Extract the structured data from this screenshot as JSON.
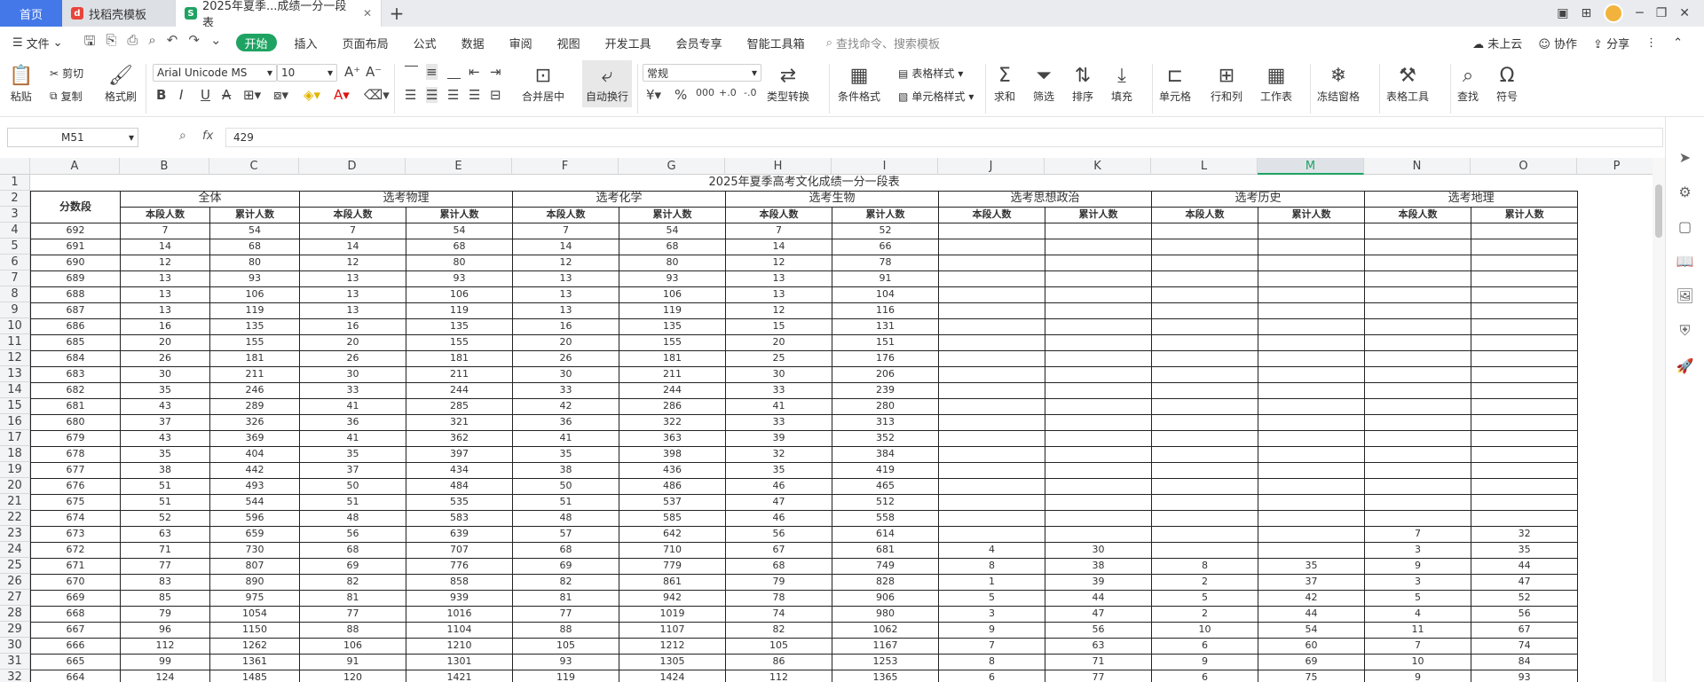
{
  "tabs": {
    "home": "首页",
    "t1": "找稻壳模板",
    "t2": "2025年夏季...成绩一分一段表"
  },
  "menu": {
    "file": "文件",
    "items": [
      "开始",
      "插入",
      "页面布局",
      "公式",
      "数据",
      "审阅",
      "视图",
      "开发工具",
      "会员专享",
      "智能工具箱"
    ],
    "search": "查找命令、搜索模板",
    "right": [
      "未上云",
      "协作",
      "分享"
    ]
  },
  "ribbon": {
    "paste": "粘贴",
    "cut": "剪切",
    "copy": "复制",
    "format_painter": "格式刷",
    "font_name": "Arial Unicode MS",
    "font_size": "10",
    "merge": "合并居中",
    "wrap": "自动换行",
    "number_format": "常规",
    "convert": "类型转换",
    "cond_format": "条件格式",
    "table_style": "表格样式",
    "cell_style": "单元格样式",
    "sum": "求和",
    "filter": "筛选",
    "sort": "排序",
    "fill": "填充",
    "cell": "单元格",
    "rowcol": "行和列",
    "worksheet": "工作表",
    "freeze": "冻结窗格",
    "table_tools": "表格工具",
    "find": "查找",
    "symbol": "符号"
  },
  "formula": {
    "cell_ref": "M51",
    "fx": "fx",
    "value": "429"
  },
  "grid": {
    "cols": [
      "A",
      "B",
      "C",
      "D",
      "E",
      "F",
      "G",
      "H",
      "I",
      "J",
      "K",
      "L",
      "M",
      "N",
      "O",
      "P"
    ],
    "selected_col": "M",
    "title": "2025年夏季高考文化成绩一分一段表",
    "score_header": "分数段",
    "groups": [
      "全体",
      "选考物理",
      "选考化学",
      "选考生物",
      "选考思想政治",
      "选考历史",
      "选考地理"
    ],
    "sub": [
      "本段人数",
      "累计人数"
    ],
    "row_numbers": [
      "1",
      "2",
      "3",
      "4",
      "5",
      "6",
      "7",
      "8",
      "9",
      "10",
      "11",
      "12",
      "13",
      "14",
      "15",
      "16",
      "17",
      "18",
      "19",
      "20",
      "21",
      "22",
      "23",
      "24",
      "25",
      "26",
      "27",
      "28",
      "29",
      "30",
      "31",
      "32"
    ],
    "rows": [
      [
        "692",
        "7",
        "54",
        "7",
        "54",
        "7",
        "54",
        "7",
        "52",
        "",
        "",
        "",
        "",
        "",
        ""
      ],
      [
        "691",
        "14",
        "68",
        "14",
        "68",
        "14",
        "68",
        "14",
        "66",
        "",
        "",
        "",
        "",
        "",
        ""
      ],
      [
        "690",
        "12",
        "80",
        "12",
        "80",
        "12",
        "80",
        "12",
        "78",
        "",
        "",
        "",
        "",
        "",
        ""
      ],
      [
        "689",
        "13",
        "93",
        "13",
        "93",
        "13",
        "93",
        "13",
        "91",
        "",
        "",
        "",
        "",
        "",
        ""
      ],
      [
        "688",
        "13",
        "106",
        "13",
        "106",
        "13",
        "106",
        "13",
        "104",
        "",
        "",
        "",
        "",
        "",
        ""
      ],
      [
        "687",
        "13",
        "119",
        "13",
        "119",
        "13",
        "119",
        "12",
        "116",
        "",
        "",
        "",
        "",
        "",
        ""
      ],
      [
        "686",
        "16",
        "135",
        "16",
        "135",
        "16",
        "135",
        "15",
        "131",
        "",
        "",
        "",
        "",
        "",
        ""
      ],
      [
        "685",
        "20",
        "155",
        "20",
        "155",
        "20",
        "155",
        "20",
        "151",
        "",
        "",
        "",
        "",
        "",
        ""
      ],
      [
        "684",
        "26",
        "181",
        "26",
        "181",
        "26",
        "181",
        "25",
        "176",
        "",
        "",
        "",
        "",
        "",
        ""
      ],
      [
        "683",
        "30",
        "211",
        "30",
        "211",
        "30",
        "211",
        "30",
        "206",
        "",
        "",
        "",
        "",
        "",
        ""
      ],
      [
        "682",
        "35",
        "246",
        "33",
        "244",
        "33",
        "244",
        "33",
        "239",
        "",
        "",
        "",
        "",
        "",
        ""
      ],
      [
        "681",
        "43",
        "289",
        "41",
        "285",
        "42",
        "286",
        "41",
        "280",
        "",
        "",
        "",
        "",
        "",
        ""
      ],
      [
        "680",
        "37",
        "326",
        "36",
        "321",
        "36",
        "322",
        "33",
        "313",
        "",
        "",
        "",
        "",
        "",
        ""
      ],
      [
        "679",
        "43",
        "369",
        "41",
        "362",
        "41",
        "363",
        "39",
        "352",
        "",
        "",
        "",
        "",
        "",
        ""
      ],
      [
        "678",
        "35",
        "404",
        "35",
        "397",
        "35",
        "398",
        "32",
        "384",
        "",
        "",
        "",
        "",
        "",
        ""
      ],
      [
        "677",
        "38",
        "442",
        "37",
        "434",
        "38",
        "436",
        "35",
        "419",
        "",
        "",
        "",
        "",
        "",
        ""
      ],
      [
        "676",
        "51",
        "493",
        "50",
        "484",
        "50",
        "486",
        "46",
        "465",
        "",
        "",
        "",
        "",
        "",
        ""
      ],
      [
        "675",
        "51",
        "544",
        "51",
        "535",
        "51",
        "537",
        "47",
        "512",
        "",
        "",
        "",
        "",
        "",
        ""
      ],
      [
        "674",
        "52",
        "596",
        "48",
        "583",
        "48",
        "585",
        "46",
        "558",
        "",
        "",
        "",
        "",
        "",
        ""
      ],
      [
        "673",
        "63",
        "659",
        "56",
        "639",
        "57",
        "642",
        "56",
        "614",
        "",
        "",
        "",
        "",
        "7",
        "32"
      ],
      [
        "672",
        "71",
        "730",
        "68",
        "707",
        "68",
        "710",
        "67",
        "681",
        "4",
        "30",
        "",
        "",
        "3",
        "35"
      ],
      [
        "671",
        "77",
        "807",
        "69",
        "776",
        "69",
        "779",
        "68",
        "749",
        "8",
        "38",
        "8",
        "35",
        "9",
        "44"
      ],
      [
        "670",
        "83",
        "890",
        "82",
        "858",
        "82",
        "861",
        "79",
        "828",
        "1",
        "39",
        "2",
        "37",
        "3",
        "47"
      ],
      [
        "669",
        "85",
        "975",
        "81",
        "939",
        "81",
        "942",
        "78",
        "906",
        "5",
        "44",
        "5",
        "42",
        "5",
        "52"
      ],
      [
        "668",
        "79",
        "1054",
        "77",
        "1016",
        "77",
        "1019",
        "74",
        "980",
        "3",
        "47",
        "2",
        "44",
        "4",
        "56"
      ],
      [
        "667",
        "96",
        "1150",
        "88",
        "1104",
        "88",
        "1107",
        "82",
        "1062",
        "9",
        "56",
        "10",
        "54",
        "11",
        "67"
      ],
      [
        "666",
        "112",
        "1262",
        "106",
        "1210",
        "105",
        "1212",
        "105",
        "1167",
        "7",
        "63",
        "6",
        "60",
        "7",
        "74"
      ],
      [
        "665",
        "99",
        "1361",
        "91",
        "1301",
        "93",
        "1305",
        "86",
        "1253",
        "8",
        "71",
        "9",
        "69",
        "10",
        "84"
      ],
      [
        "664",
        "124",
        "1485",
        "120",
        "1421",
        "119",
        "1424",
        "112",
        "1365",
        "6",
        "77",
        "6",
        "75",
        "9",
        "93"
      ]
    ]
  }
}
